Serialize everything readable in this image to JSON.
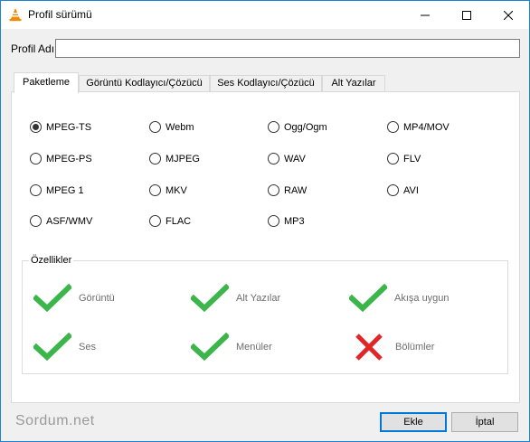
{
  "window": {
    "title": "Profil sürümü",
    "icon": "vlc-cone-icon"
  },
  "profile": {
    "label": "Profil Adı",
    "value": ""
  },
  "tabs": [
    {
      "label": "Paketleme",
      "active": true
    },
    {
      "label": "Görüntü Kodlayıcı/Çözücü",
      "active": false
    },
    {
      "label": "Ses Kodlayıcı/Çözücü",
      "active": false
    },
    {
      "label": "Alt Yazılar",
      "active": false
    }
  ],
  "formats": [
    {
      "label": "MPEG-TS",
      "selected": true
    },
    {
      "label": "Webm",
      "selected": false
    },
    {
      "label": "Ogg/Ogm",
      "selected": false
    },
    {
      "label": "MP4/MOV",
      "selected": false
    },
    {
      "label": "MPEG-PS",
      "selected": false
    },
    {
      "label": "MJPEG",
      "selected": false
    },
    {
      "label": "WAV",
      "selected": false
    },
    {
      "label": "FLV",
      "selected": false
    },
    {
      "label": "MPEG 1",
      "selected": false
    },
    {
      "label": "MKV",
      "selected": false
    },
    {
      "label": "RAW",
      "selected": false
    },
    {
      "label": "AVI",
      "selected": false
    },
    {
      "label": "ASF/WMV",
      "selected": false
    },
    {
      "label": "FLAC",
      "selected": false
    },
    {
      "label": "MP3",
      "selected": false
    }
  ],
  "features": {
    "title": "Özellikler",
    "items": [
      {
        "label": "Görüntü",
        "supported": true
      },
      {
        "label": "Alt Yazılar",
        "supported": true
      },
      {
        "label": "Akışa uygun",
        "supported": true
      },
      {
        "label": "Ses",
        "supported": true
      },
      {
        "label": "Menüler",
        "supported": true
      },
      {
        "label": "Bölümler",
        "supported": false
      }
    ]
  },
  "footer": {
    "watermark": "Sordum.net",
    "add_label": "Ekle",
    "cancel_label": "İptal"
  },
  "colors": {
    "check": "#3cb54a",
    "cross": "#e02626",
    "accent": "#0078d7"
  }
}
